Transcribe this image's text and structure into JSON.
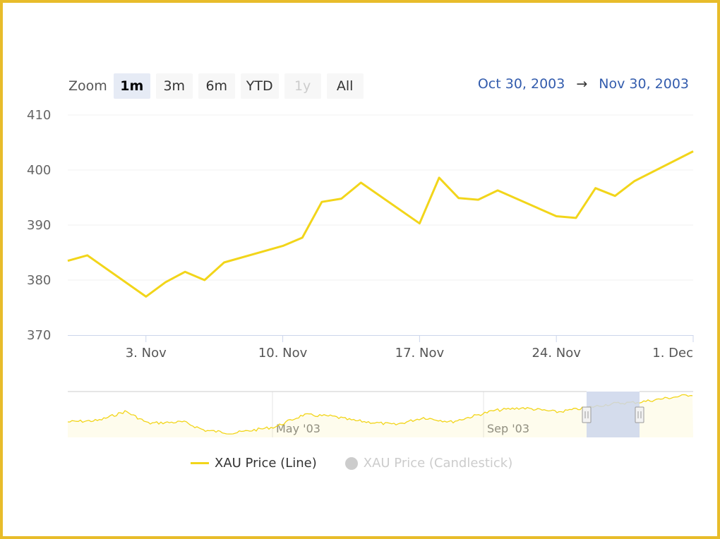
{
  "zoom": {
    "label": "Zoom",
    "buttons": [
      {
        "label": "1m",
        "state": "active"
      },
      {
        "label": "3m",
        "state": "normal"
      },
      {
        "label": "6m",
        "state": "normal"
      },
      {
        "label": "YTD",
        "state": "normal"
      },
      {
        "label": "1y",
        "state": "disabled"
      },
      {
        "label": "All",
        "state": "normal"
      }
    ]
  },
  "range": {
    "from": "Oct 30, 2003",
    "arrow": "→",
    "to": "Nov 30, 2003"
  },
  "navigator": {
    "labels": [
      "May '03",
      "Sep '03"
    ]
  },
  "legend": [
    {
      "label": "XAU Price (Line)",
      "visible": true
    },
    {
      "label": "XAU Price (Candlestick)",
      "visible": false
    }
  ],
  "colors": {
    "series": "#f2d51a",
    "frame": "#e8bc2a",
    "accent": "#335cad",
    "navigatorMask": "#ccd6eb"
  },
  "chart_data": {
    "type": "line",
    "title": "",
    "xlabel": "",
    "ylabel": "",
    "ylim": [
      370,
      410
    ],
    "yticks": [
      "410",
      "400",
      "390",
      "380",
      "370"
    ],
    "xticks": [
      "3. Nov",
      "10. Nov",
      "17. Nov",
      "24. Nov",
      "1. Dec"
    ],
    "xlim": [
      "2003-10-30",
      "2003-12-01"
    ],
    "series": [
      {
        "name": "XAU Price (Line)",
        "x": [
          "2003-10-30",
          "2003-10-31",
          "2003-11-03",
          "2003-11-04",
          "2003-11-05",
          "2003-11-06",
          "2003-11-07",
          "2003-11-10",
          "2003-11-11",
          "2003-11-12",
          "2003-11-13",
          "2003-11-14",
          "2003-11-17",
          "2003-11-18",
          "2003-11-19",
          "2003-11-20",
          "2003-11-21",
          "2003-11-24",
          "2003-11-25",
          "2003-11-26",
          "2003-11-27",
          "2003-11-28",
          "2003-12-01"
        ],
        "values": [
          383.5,
          384.5,
          377.0,
          379.6,
          381.5,
          380.0,
          383.2,
          386.2,
          387.7,
          394.2,
          394.8,
          397.7,
          390.3,
          398.6,
          394.9,
          394.6,
          396.3,
          391.6,
          391.3,
          396.7,
          395.3,
          398.0,
          403.4
        ]
      }
    ]
  }
}
